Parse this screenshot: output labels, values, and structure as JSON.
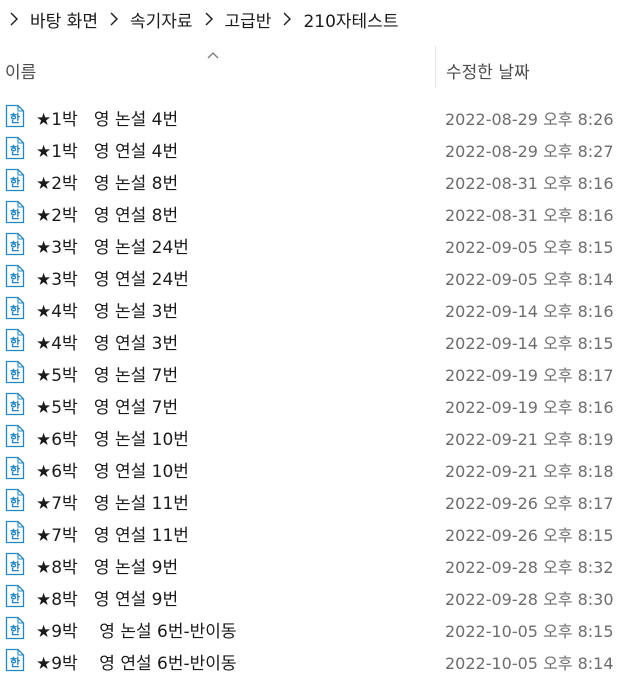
{
  "breadcrumb": {
    "items": [
      "바탕 화면",
      "속기자료",
      "고급반",
      "210자테스트"
    ],
    "separator_icon": "chevron-right-icon"
  },
  "columns": {
    "name_label": "이름",
    "date_label": "수정한 날짜",
    "sort_icon": "chevron-up-icon"
  },
  "file_icon": "hwp-document-icon",
  "colors": {
    "icon_blue": "#1e88c8",
    "date_text": "#6d6d6d"
  },
  "files": [
    {
      "name": "★1박   영 논설 4번",
      "date": "2022-08-29 오후 8:26"
    },
    {
      "name": "★1박   영 연설 4번",
      "date": "2022-08-29 오후 8:27"
    },
    {
      "name": "★2박   영 논설 8번",
      "date": "2022-08-31 오후 8:16"
    },
    {
      "name": "★2박   영 연설 8번",
      "date": "2022-08-31 오후 8:16"
    },
    {
      "name": "★3박   영 논설 24번",
      "date": "2022-09-05 오후 8:15"
    },
    {
      "name": "★3박   영 연설 24번",
      "date": "2022-09-05 오후 8:14"
    },
    {
      "name": "★4박   영 논설 3번",
      "date": "2022-09-14 오후 8:16"
    },
    {
      "name": "★4박   영 연설 3번",
      "date": "2022-09-14 오후 8:15"
    },
    {
      "name": "★5박   영 논설 7번",
      "date": "2022-09-19 오후 8:17"
    },
    {
      "name": "★5박   영 연설 7번",
      "date": "2022-09-19 오후 8:16"
    },
    {
      "name": "★6박   영 논설 10번",
      "date": "2022-09-21 오후 8:19"
    },
    {
      "name": "★6박   영 연설 10번",
      "date": "2022-09-21 오후 8:18"
    },
    {
      "name": "★7박   영 논설 11번",
      "date": "2022-09-26 오후 8:17"
    },
    {
      "name": "★7박   영 연설 11번",
      "date": "2022-09-26 오후 8:15"
    },
    {
      "name": "★8박   영 논설 9번",
      "date": "2022-09-28 오후 8:32"
    },
    {
      "name": "★8박   영 연설 9번",
      "date": "2022-09-28 오후 8:30"
    },
    {
      "name": "★9박    영 논설 6번-반이동",
      "date": "2022-10-05 오후 8:15"
    },
    {
      "name": "★9박    영 연설 6번-반이동",
      "date": "2022-10-05 오후 8:14"
    }
  ]
}
